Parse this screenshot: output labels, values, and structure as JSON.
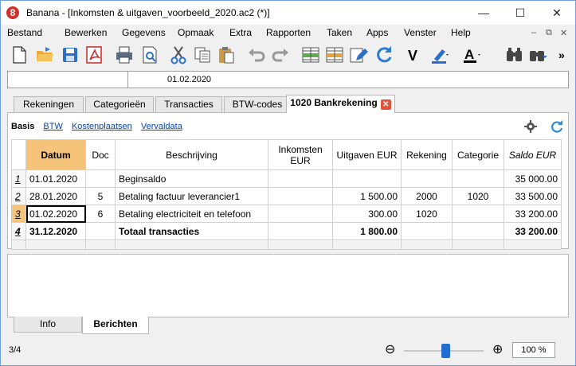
{
  "window": {
    "title": "Banana - [Inkomsten & uitgaven_voorbeeld_2020.ac2 (*)]",
    "app_icon": "8",
    "controls": [
      "—",
      "☐",
      "✕"
    ]
  },
  "menu": {
    "items": [
      "Bestand",
      "Bewerken",
      "Gegevens",
      "Opmaak",
      "Extra",
      "Rapporten",
      "Taken",
      "Apps",
      "Venster",
      "Help"
    ],
    "mdi_controls": [
      "–",
      "⧉",
      "✕"
    ]
  },
  "toolbar": {
    "icons": [
      "new-file-icon",
      "open-folder-icon",
      "save-icon",
      "pdf-icon",
      "print-icon",
      "print-preview-icon",
      "cut-icon",
      "copy-icon",
      "paste-icon",
      "undo-icon",
      "redo-icon",
      "insert-row-icon",
      "delete-row-icon",
      "edit-pencil-icon",
      "refresh-icon",
      "check-icon",
      "highlighter-icon",
      "font-color-icon",
      "find-icon",
      "find-next-icon"
    ],
    "more": "»"
  },
  "cellbar": {
    "value": "01.02.2020"
  },
  "tabs": {
    "items": [
      "Rekeningen",
      "Categorieën",
      "Transacties",
      "BTW-codes"
    ],
    "active": "1020 Bankrekening"
  },
  "views": {
    "current": "Basis",
    "links": [
      "BTW",
      "Kostenplaatsen",
      "Vervaldata"
    ]
  },
  "table": {
    "headers": [
      "Datum",
      "Doc",
      "Beschrijving",
      "Inkomsten EUR",
      "Uitgaven EUR",
      "Rekening",
      "Categorie",
      "Saldo EUR"
    ],
    "rows": [
      {
        "n": "1",
        "datum": "01.01.2020",
        "doc": "",
        "beschrijving": "Beginsaldo",
        "inkomsten": "",
        "uitgaven": "",
        "rekening": "",
        "categorie": "",
        "saldo": "35 000.00"
      },
      {
        "n": "2",
        "datum": "28.01.2020",
        "doc": "5",
        "beschrijving": "Betaling factuur leverancier1",
        "inkomsten": "",
        "uitgaven": "1 500.00",
        "rekening": "2000",
        "categorie": "1020",
        "saldo": "33 500.00"
      },
      {
        "n": "3",
        "datum": "01.02.2020",
        "doc": "6",
        "beschrijving": "Betaling electriciteit en telefoon",
        "inkomsten": "",
        "uitgaven": "300.00",
        "rekening": "1020",
        "categorie": "",
        "saldo": "33 200.00"
      },
      {
        "n": "4",
        "datum": "31.12.2020",
        "doc": "",
        "beschrijving": "Totaal transacties",
        "inkomsten": "",
        "uitgaven": "1 800.00",
        "rekening": "",
        "categorie": "",
        "saldo": "33 200.00"
      }
    ]
  },
  "bottom_tabs": {
    "items": [
      "Info"
    ],
    "active": "Berichten"
  },
  "status": {
    "position": "3/4",
    "zoom": "100 %",
    "zoom_level": 0.5
  },
  "colors": {
    "accent_header": "#f5c37a",
    "link": "#0645ad",
    "close_tab": "#e5533d",
    "slider": "#1e6fd0"
  }
}
